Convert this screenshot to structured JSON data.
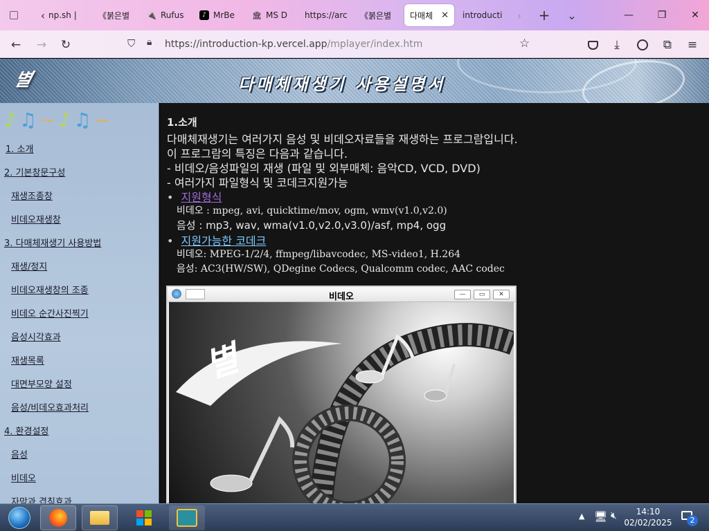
{
  "browser": {
    "tabs": [
      {
        "label": "np.sh |",
        "icon": "page-icon"
      },
      {
        "label": "《붉은별",
        "icon": "page-icon"
      },
      {
        "label": "Rufus",
        "icon": "rufus-icon"
      },
      {
        "label": "MrBe",
        "icon": "tiktok-icon"
      },
      {
        "label": "MS D",
        "icon": "museum-icon"
      },
      {
        "label": "https://arc",
        "icon": "page-icon"
      },
      {
        "label": "《붉은별",
        "icon": "page-icon"
      },
      {
        "label": "다매체",
        "icon": "page-icon",
        "active": true
      },
      {
        "label": "introducti",
        "icon": "page-icon"
      }
    ],
    "url_main": "https://introduction-kp.vercel.app",
    "url_path": "/mplayer/index.htm"
  },
  "banner": {
    "logo": "별",
    "title": "다매체재생기 사용설명서"
  },
  "sidebar": {
    "items": [
      "1. 소개",
      "2. 기본창문구성",
      "재생조종창",
      "비데오재생창",
      "3. 다매체재생기 사용방법",
      "재생/정지",
      "비데오재생창의 조종",
      "비데오 순간사진찍기",
      "음성시각효과",
      "재생목록",
      "대면부모양 설정",
      "음성/비데오효과처리",
      "4. 환경설정",
      "음성",
      "비데오",
      "자막과 겹침효과"
    ]
  },
  "content": {
    "heading": "1.소개",
    "p1": "다매체재생기는 여러가지 음성 및 비데오자료들을 재생하는 프로그람입니다.",
    "p2": "이 프로그람의 특징은 다음과 같습니다.",
    "p3": "- 비데오/음성파일의 재생 (파일 및 외부매체: 음악CD, VCD, DVD)",
    "p4": "- 여러가지 파일형식 및 코데크지원가능",
    "bullet1": "지원형식",
    "fmt_video": "비데오 : mpeg, avi, quicktime/mov, ogm, wmv(v1.0,v2.0)",
    "fmt_audio": "음성 : mp3, wav, wma(v1.0,v2.0,v3.0)/asf, mp4, ogg",
    "bullet2": "지원가능한 코데크",
    "codec_video": "비데오: MPEG-1/2/4, ffmpeg/libavcodec,  MS-video1, H.264",
    "codec_audio": "음성: AC3(HW/SW), QDegine Codecs, Qualcomm codec, AAC codec",
    "video_window_title": "비데오"
  },
  "taskbar": {
    "time": "14:10",
    "date": "02/02/2025",
    "notification_count": "2"
  }
}
